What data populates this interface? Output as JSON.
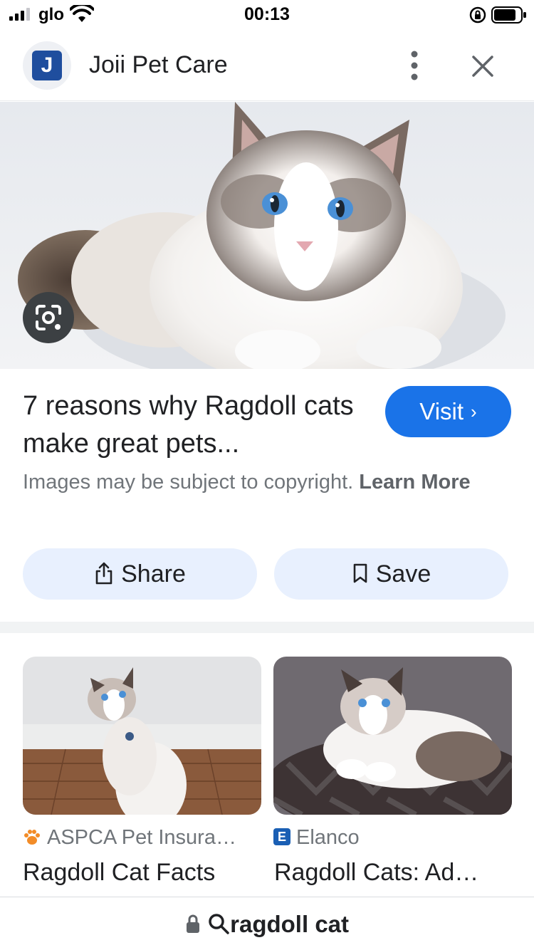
{
  "status_bar": {
    "carrier": "glo",
    "time": "00:13",
    "signal_icon": "cellular-signal-icon",
    "wifi_icon": "wifi-icon",
    "battery_icon": "battery-icon",
    "rotation_icon": "rotation-lock-icon"
  },
  "header": {
    "site_logo_letter": "J",
    "site_name": "Joii Pet Care",
    "more_icon": "more-vertical-icon",
    "close_icon": "close-icon"
  },
  "hero": {
    "image_subject": "ragdoll-cat-photo",
    "lens_icon": "google-lens-icon"
  },
  "result": {
    "title": "7 reasons why Ragdoll cats make great pets...",
    "visit_label": "Visit",
    "visit_chevron": "›",
    "copyright_text": "Images may be subject to copyright.",
    "learn_more": "Learn More"
  },
  "actions": {
    "share_label": "Share",
    "save_label": "Save"
  },
  "related": [
    {
      "source": "ASPCA Pet Insura…",
      "title": "Ragdoll Cat Facts",
      "favicon": "paw-icon"
    },
    {
      "source": "Elanco",
      "title": "Ragdoll Cats: Ad…",
      "favicon_letter": "E"
    }
  ],
  "bottom_bar": {
    "query": "ragdoll cat",
    "lock_icon": "lock-icon",
    "search_icon": "search-icon"
  },
  "colors": {
    "accent": "#1a73e8",
    "pill_bg": "#e8f0fe",
    "secondary_text": "#70757a"
  }
}
